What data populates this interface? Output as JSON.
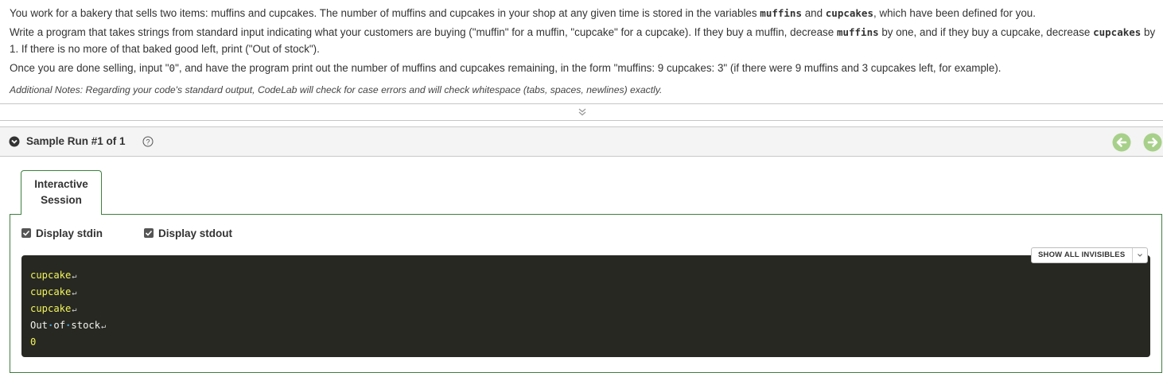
{
  "problem": {
    "p1_a": "You work for a bakery that sells two items: muffins and cupcakes. The number of muffins and cupcakes in your shop at any given time is stored in the variables ",
    "p1_var1": "muffins",
    "p1_b": " and ",
    "p1_var2": "cupcakes",
    "p1_c": ", which have been defined for you.",
    "p2_a": "Write a program that takes strings from standard input indicating what your customers are buying (\"muffin\" for a muffin, \"cupcake\" for a cupcake). If they buy a muffin, decrease ",
    "p2_var1": "muffins",
    "p2_b": " by one, and if they buy a cupcake, decrease ",
    "p2_var2": "cupcakes",
    "p2_c": " by 1. If there is no more of that baked good left, print (\"Out of stock\").",
    "p3_a": "Once you are done selling, input \"",
    "p3_code": "0",
    "p3_b": "\", and have the program print out the number of muffins and cupcakes remaining, in the form \"muffins: 9 cupcakes: 3\" (if there were 9 muffins and 3 cupcakes left, for example).",
    "note": "Additional Notes: Regarding your code's standard output, CodeLab will check for case errors and will check whitespace (tabs, spaces, newlines) exactly."
  },
  "sample_run": {
    "title": "Sample Run #1 of 1"
  },
  "tabs": {
    "interactive_line1": "Interactive",
    "interactive_line2": "Session"
  },
  "options": {
    "display_stdin": "Display stdin",
    "display_stdout": "Display stdout",
    "show_invisibles": "SHOW ALL INVISIBLES"
  },
  "console": {
    "lines": [
      {
        "type": "stdin",
        "text": "cupcake"
      },
      {
        "type": "stdin",
        "text": "cupcake"
      },
      {
        "type": "stdin",
        "text": "cupcake"
      },
      {
        "type": "stdout",
        "text": "Out of stock"
      },
      {
        "type": "stdin",
        "text": "0"
      }
    ]
  },
  "colors": {
    "stdin": "#f1f55a",
    "stdout": "#f3f3f0",
    "console_bg": "#272822",
    "tab_border": "#3f7f3f",
    "nav_arrow": "#a7d08a"
  },
  "icons": [
    "chevron-down-circle-icon",
    "help-circle-icon",
    "arrow-left-circle-icon",
    "arrow-right-circle-icon",
    "double-chevron-down-icon",
    "checkbox-checked-icon",
    "caret-down-icon",
    "newline-icon",
    "space-dot-icon"
  ]
}
